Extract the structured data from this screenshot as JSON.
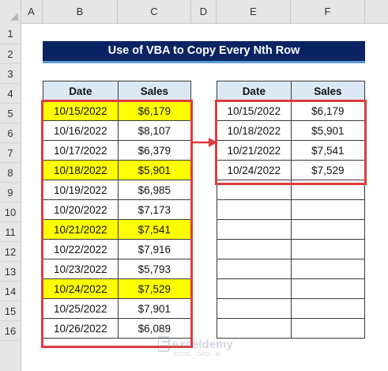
{
  "columns": [
    "A",
    "B",
    "C",
    "D",
    "E",
    "F"
  ],
  "rows": [
    "1",
    "2",
    "3",
    "4",
    "5",
    "6",
    "7",
    "8",
    "9",
    "10",
    "11",
    "12",
    "13",
    "14",
    "15",
    "16"
  ],
  "title": "Use of VBA to Copy Every Nth Row",
  "left_table": {
    "headers": [
      "Date",
      "Sales"
    ],
    "rows": [
      {
        "date": "10/15/2022",
        "sales": "$6,179",
        "highlight": true
      },
      {
        "date": "10/16/2022",
        "sales": "$8,107",
        "highlight": false
      },
      {
        "date": "10/17/2022",
        "sales": "$6,379",
        "highlight": false
      },
      {
        "date": "10/18/2022",
        "sales": "$5,901",
        "highlight": true
      },
      {
        "date": "10/19/2022",
        "sales": "$6,985",
        "highlight": false
      },
      {
        "date": "10/20/2022",
        "sales": "$7,173",
        "highlight": false
      },
      {
        "date": "10/21/2022",
        "sales": "$7,541",
        "highlight": true
      },
      {
        "date": "10/22/2022",
        "sales": "$7,916",
        "highlight": false
      },
      {
        "date": "10/23/2022",
        "sales": "$5,793",
        "highlight": false
      },
      {
        "date": "10/24/2022",
        "sales": "$7,529",
        "highlight": true
      },
      {
        "date": "10/25/2022",
        "sales": "$7,901",
        "highlight": false
      },
      {
        "date": "10/26/2022",
        "sales": "$6,089",
        "highlight": false
      }
    ]
  },
  "right_table": {
    "headers": [
      "Date",
      "Sales"
    ],
    "rows": [
      {
        "date": "10/15/2022",
        "sales": "$6,179"
      },
      {
        "date": "10/18/2022",
        "sales": "$5,901"
      },
      {
        "date": "10/21/2022",
        "sales": "$7,541"
      },
      {
        "date": "10/24/2022",
        "sales": "$7,529"
      },
      {
        "date": "",
        "sales": ""
      },
      {
        "date": "",
        "sales": ""
      },
      {
        "date": "",
        "sales": ""
      },
      {
        "date": "",
        "sales": ""
      },
      {
        "date": "",
        "sales": ""
      },
      {
        "date": "",
        "sales": ""
      },
      {
        "date": "",
        "sales": ""
      },
      {
        "date": "",
        "sales": ""
      }
    ]
  },
  "watermark": {
    "name": "exceldemy",
    "tagline": "EXCEL · DATA · BI"
  },
  "colors": {
    "title_bg": "#0a2463",
    "header_fill": "#dce9f5",
    "highlight": "#ffff00",
    "red_outline": "#e03c3c"
  }
}
